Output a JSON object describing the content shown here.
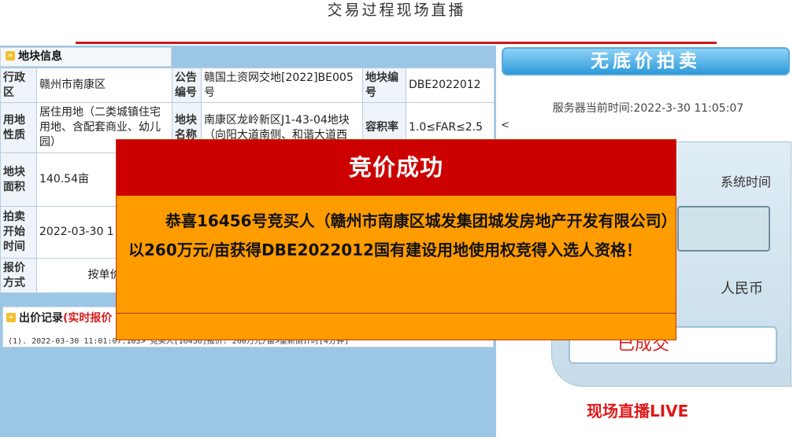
{
  "page_title": "交易过程现场直播",
  "plot_info": {
    "header": "地块信息",
    "rows": [
      [
        "行政区",
        "赣州市南康区",
        "公告编号",
        "赣国土资网交地[2022]BE005号",
        "地块编号",
        "DBE2022012"
      ],
      [
        "用地性质",
        "居住用地（二类城镇住宅用地、含配套商业、幼儿园）",
        "地块名称",
        "南康区龙岭新区J1-43-04地块（向阳大道南侧、和谐大道西",
        "容积率",
        "1.0≤FAR≤2.5"
      ],
      [
        "地块面积",
        "140.54亩",
        "",
        "",
        "",
        ""
      ],
      [
        "拍卖开始时间",
        "2022-03-30 1",
        "",
        "",
        "",
        ""
      ],
      [
        "报价方式",
        "按单价",
        "",
        "",
        "",
        ""
      ]
    ]
  },
  "record": {
    "title": "出价记录",
    "live": "(实时报价",
    "line": "(1). 2022-03-30 11:01:07.103> 竞买人[16456]报价: 260万元/亩>重新倒计时[4分钟]"
  },
  "auction": {
    "header": "无底价拍卖",
    "server_time": "服务器当前时间:2022-3-30 11:05:07",
    "lt_mark": "<",
    "sys_time_label": "系统时间",
    "currency": "人民币",
    "status": "已成交",
    "live": "现场直播LIVE"
  },
  "modal": {
    "title": "竞价成功",
    "body": "恭喜16456号竞买人（赣州市南康区城发集团城发房地产开发有限公司）以260万元/亩获得DBE2022012国有建设用地使用权竞得入选人资格！"
  },
  "colors": {
    "accent_red": "#cc0000",
    "modal_orange": "#ff9c00",
    "panel_blue": "#9cc6e6"
  }
}
